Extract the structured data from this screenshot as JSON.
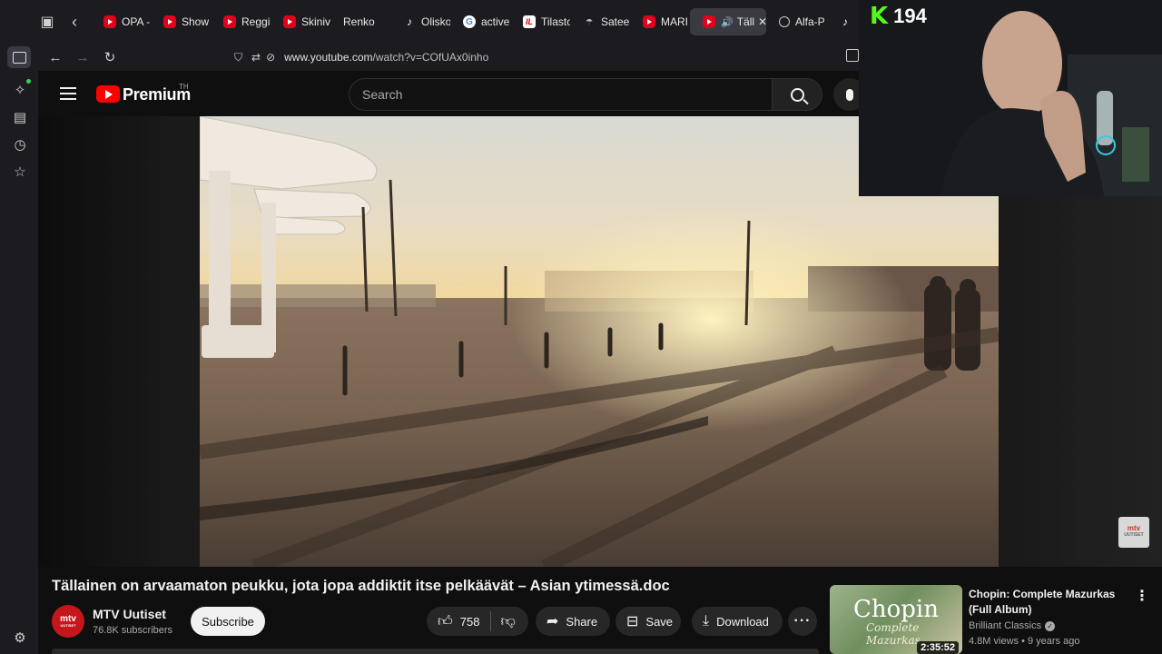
{
  "browser": {
    "tabs": [
      {
        "label": "OPA -",
        "icon": "youtube-icon"
      },
      {
        "label": "Show",
        "icon": "youtube-icon"
      },
      {
        "label": "Reggi",
        "icon": "youtube-icon"
      },
      {
        "label": "Skini​v",
        "icon": "youtube-icon"
      },
      {
        "label": "Renko",
        "icon": "kick-icon"
      },
      {
        "label": "Olisko",
        "icon": "tiktok-icon"
      },
      {
        "label": "active",
        "icon": "google-icon"
      },
      {
        "label": "Tilasto",
        "icon": "iltalehti-icon"
      },
      {
        "label": "Sateen",
        "icon": "weather-icon"
      },
      {
        "label": "MARI",
        "icon": "youtube-icon"
      },
      {
        "label": "Täll",
        "icon": "youtube-icon",
        "active": true
      },
      {
        "label": "Alfa-P",
        "icon": "alfa-icon"
      },
      {
        "label": "",
        "icon": "tiktok-icon"
      }
    ],
    "url_host": "www.youtube.com",
    "url_path": "/watch?v=COfUAx0inho"
  },
  "youtube": {
    "brand": "Premium",
    "country": "TH",
    "search_placeholder": "Search"
  },
  "stream_overlay": {
    "platform_glyph": "K",
    "viewer_count": "194"
  },
  "video": {
    "title": "Tällainen on arvaamaton peukku, jota jopa addiktit itse pelkäävät – Asian ytimessä.doc",
    "watermark": "mtv",
    "watermark_sub": "UUTISET",
    "channel": {
      "avatar_text": "mtv",
      "avatar_sub": "UUTISET",
      "name": "MTV Uutiset",
      "subscribers": "76.8K subscribers"
    },
    "subscribe_label": "Subscribe",
    "likes": "758",
    "share_label": "Share",
    "save_label": "Save",
    "download_label": "Download"
  },
  "recommendation": {
    "thumb_title": "Chopin",
    "thumb_sub": "Complete Mazurkas",
    "duration": "2:35:52",
    "title": "Chopin: Complete Mazurkas (Full Album)",
    "channel": "Brilliant Classics",
    "meta": "4.8M views • 9 years ago"
  },
  "colors": {
    "youtube_red": "#ff0000",
    "kick_green": "#53fc18",
    "mtv_red": "#c4161c"
  }
}
